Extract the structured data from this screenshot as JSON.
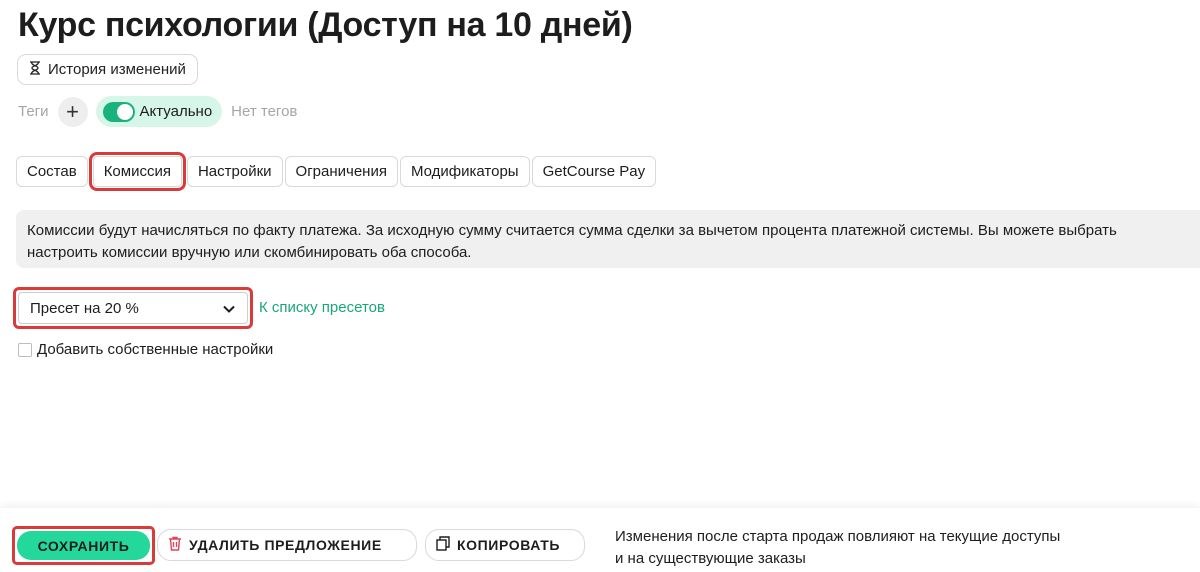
{
  "header": {
    "title": "Курс психологии (Доступ на 10 дней)",
    "history_label": "История изменений"
  },
  "tags": {
    "label": "Теги",
    "add_symbol": "+",
    "status_label": "Актуально",
    "status_on": true,
    "empty_label": "Нет тегов"
  },
  "tabs": [
    {
      "label": "Состав",
      "active": false
    },
    {
      "label": "Комиссия",
      "active": true
    },
    {
      "label": "Настройки",
      "active": false
    },
    {
      "label": "Ограничения",
      "active": false
    },
    {
      "label": "Модификаторы",
      "active": false
    },
    {
      "label": "GetCourse Pay",
      "active": false
    }
  ],
  "info": {
    "line1": "Комиссии будут начисляться по факту платежа. За исходную сумму считается сумма сделки за вычетом процента платежной системы. Вы можете выбрать",
    "line2": "настроить комиссии вручную или скомбинировать оба способа."
  },
  "preset": {
    "selected": "Пресет на 20 %",
    "link_label": "К списку пресетов"
  },
  "custom_settings": {
    "label": "Добавить собственные настройки",
    "checked": false
  },
  "footer": {
    "save_label": "СОХРАНИТЬ",
    "delete_label": "УДАЛИТЬ ПРЕДЛОЖЕНИЕ",
    "copy_label": "КОПИРОВАТЬ",
    "notice_line1": "Изменения после старта продаж повлияют на текущие доступы",
    "notice_line2": "и на существующие заказы"
  },
  "colors": {
    "accent": "#19b27d",
    "save_button": "#23d89a",
    "highlight": "#d93a3a",
    "link": "#19a874"
  }
}
